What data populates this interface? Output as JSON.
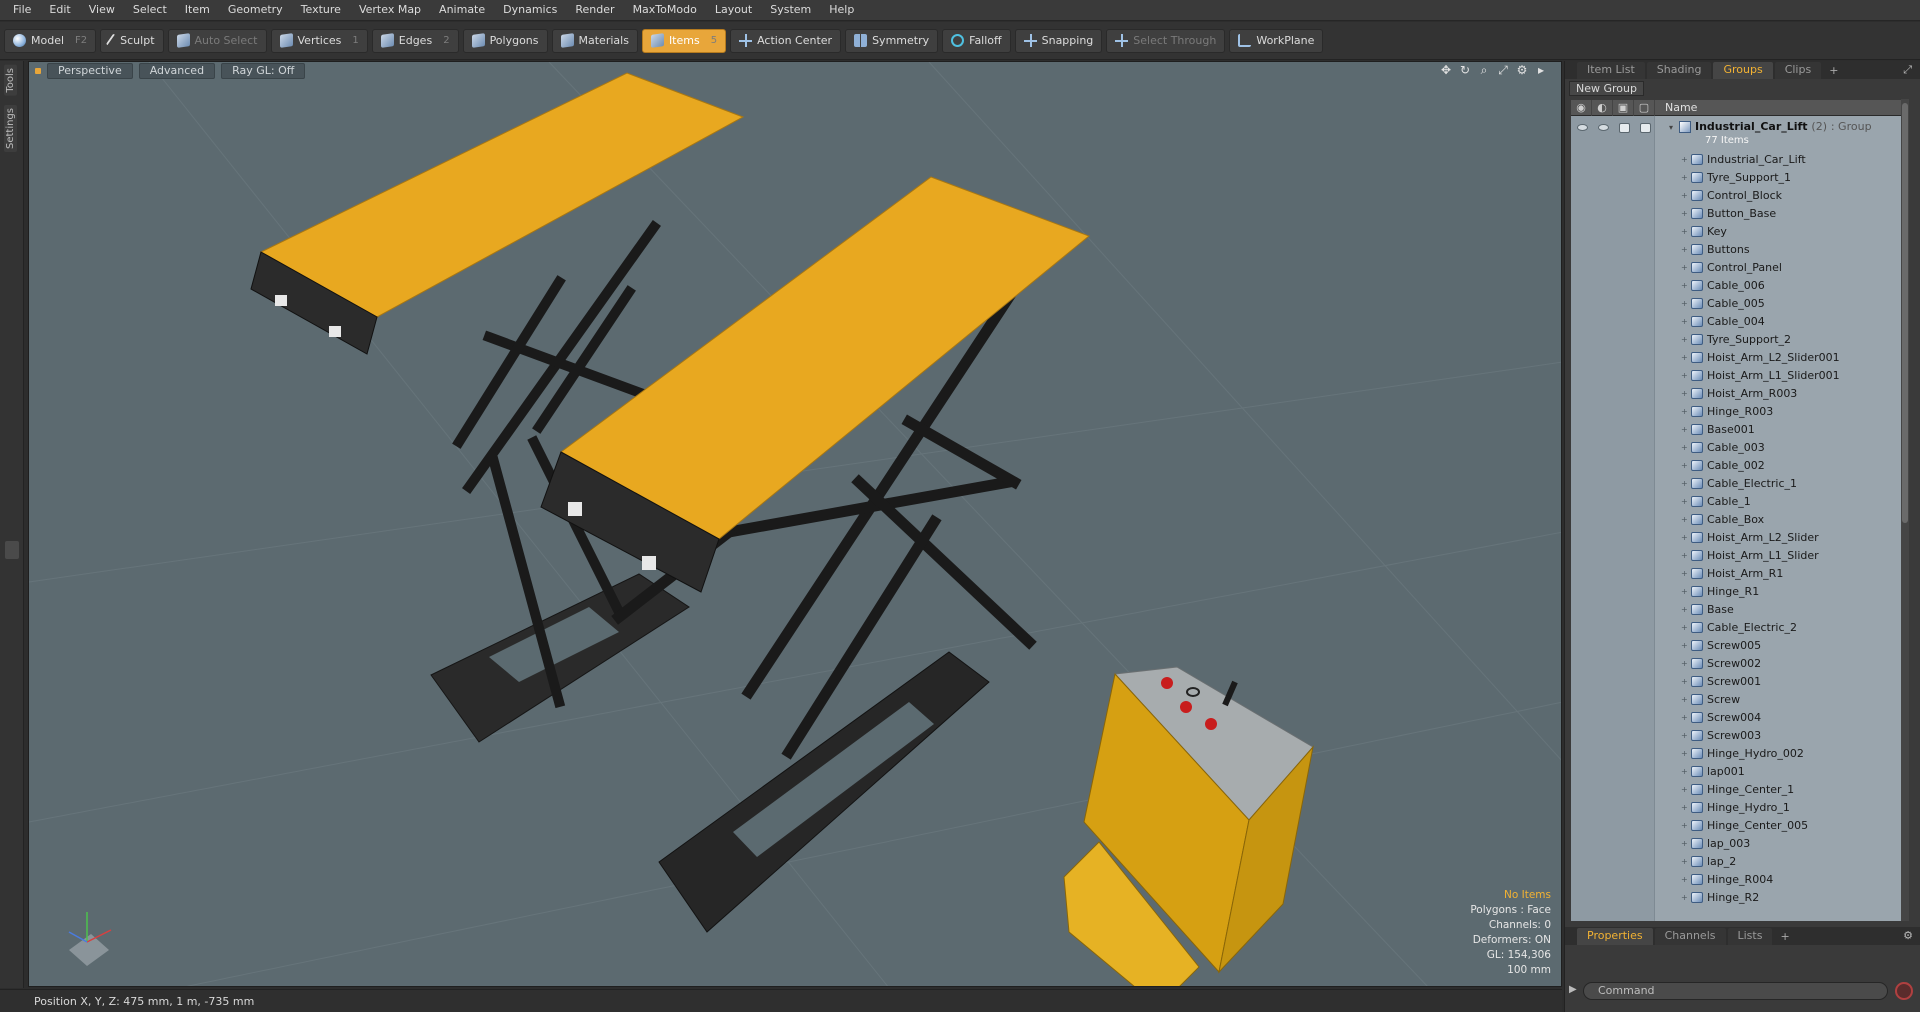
{
  "menu": [
    "File",
    "Edit",
    "View",
    "Select",
    "Item",
    "Geometry",
    "Texture",
    "Vertex Map",
    "Animate",
    "Dynamics",
    "Render",
    "MaxToModo",
    "Layout",
    "System",
    "Help"
  ],
  "toolbar": {
    "model": {
      "label": "Model",
      "key": "F2"
    },
    "sculpt": {
      "label": "Sculpt"
    },
    "auto_select": {
      "label": "Auto Select"
    },
    "vertices": {
      "label": "Vertices",
      "key": "1"
    },
    "edges": {
      "label": "Edges",
      "key": "2"
    },
    "polygons": {
      "label": "Polygons"
    },
    "materials": {
      "label": "Materials"
    },
    "items": {
      "label": "Items",
      "key": "5"
    },
    "action_center": {
      "label": "Action Center"
    },
    "symmetry": {
      "label": "Symmetry"
    },
    "falloff": {
      "label": "Falloff"
    },
    "snapping": {
      "label": "Snapping"
    },
    "select_through": {
      "label": "Select Through"
    },
    "workplane": {
      "label": "WorkPlane"
    }
  },
  "leftstrip": {
    "tools": "Tools",
    "settings": "Settings"
  },
  "viewport": {
    "view_mode": "Perspective",
    "advanced": "Advanced",
    "raygl": "Ray GL: Off",
    "info": {
      "selection": "No Items",
      "polygons": "Polygons : Face",
      "channels": "Channels: 0",
      "deformers": "Deformers: ON",
      "gl": "GL: 154,306",
      "scale": "100 mm"
    },
    "colors": {
      "background": "#5c6a70",
      "platform": "#e8a820",
      "frame": "#1c1c1c"
    }
  },
  "statusbar": {
    "position": "Position X, Y, Z:  475 mm, 1 m, -735 mm"
  },
  "panel": {
    "tabs": [
      "Item List",
      "Shading",
      "Groups",
      "Clips"
    ],
    "active_tab": "Groups",
    "new_group": "New Group",
    "name_header": "Name",
    "root": {
      "name": "Industrial_Car_Lift",
      "count": "(2)",
      "type": ": Group",
      "sub": "77 Items"
    },
    "items": [
      "Industrial_Car_Lift",
      "Tyre_Support_1",
      "Control_Block",
      "Button_Base",
      "Key",
      "Buttons",
      "Control_Panel",
      "Cable_006",
      "Cable_005",
      "Cable_004",
      "Tyre_Support_2",
      "Hoist_Arm_L2_Slider001",
      "Hoist_Arm_L1_Slider001",
      "Hoist_Arm_R003",
      "Hinge_R003",
      "Base001",
      "Cable_003",
      "Cable_002",
      "Cable_Electric_1",
      "Cable_1",
      "Cable_Box",
      "Hoist_Arm_L2_Slider",
      "Hoist_Arm_L1_Slider",
      "Hoist_Arm_R1",
      "Hinge_R1",
      "Base",
      "Cable_Electric_2",
      "Screw005",
      "Screw002",
      "Screw001",
      "Screw",
      "Screw004",
      "Screw003",
      "Hinge_Hydro_002",
      "lap001",
      "Hinge_Center_1",
      "Hinge_Hydro_1",
      "Hinge_Center_005",
      "lap_003",
      "lap_2",
      "Hinge_R004",
      "Hinge_R2"
    ]
  },
  "properties": {
    "tabs": [
      "Properties",
      "Channels",
      "Lists"
    ],
    "active_tab": "Properties",
    "command_placeholder": "Command"
  }
}
